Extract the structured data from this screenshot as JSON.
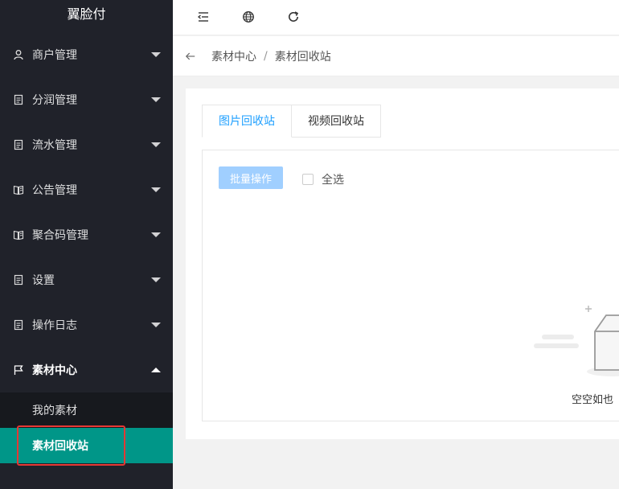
{
  "sidebar": {
    "brand": "翼脸付",
    "partial_item": "",
    "items": [
      {
        "label": "商户管理",
        "icon": "user-icon"
      },
      {
        "label": "分润管理",
        "icon": "clipboard-icon"
      },
      {
        "label": "流水管理",
        "icon": "clipboard-icon"
      },
      {
        "label": "公告管理",
        "icon": "book-icon"
      },
      {
        "label": "聚合码管理",
        "icon": "book-icon"
      },
      {
        "label": "设置",
        "icon": "clipboard-icon"
      },
      {
        "label": "操作日志",
        "icon": "clipboard-icon"
      },
      {
        "label": "素材中心",
        "icon": "flag-icon"
      }
    ],
    "submenu": [
      "我的素材",
      "素材回收站"
    ]
  },
  "header": {
    "icons": [
      "menu-fold-icon",
      "globe-icon",
      "refresh-icon"
    ]
  },
  "breadcrumb": {
    "first": "素材中心",
    "separator": "/",
    "second": "素材回收站"
  },
  "tabs": [
    "图片回收站",
    "视频回收站"
  ],
  "toolbar": {
    "batch_label": "批量操作",
    "select_all_label": "全选"
  },
  "empty": {
    "text": "空空如也"
  },
  "colors": {
    "sidebar_bg": "#20222a",
    "active_teal": "#009688",
    "highlight_red": "#e53935",
    "tab_active_blue": "#1e9fff",
    "button_disabled_blue": "#a0cfff"
  }
}
